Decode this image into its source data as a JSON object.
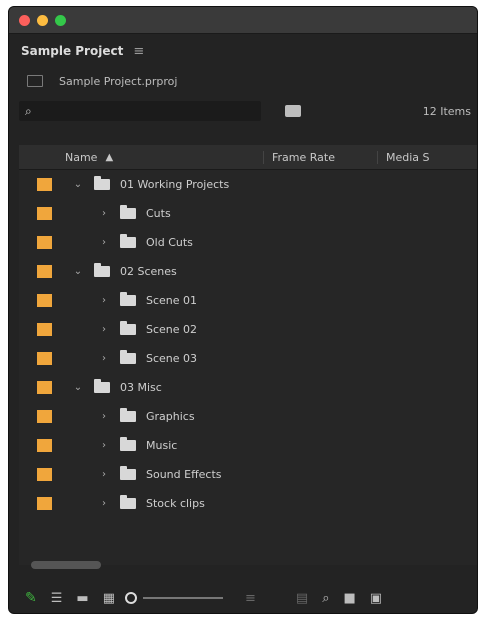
{
  "window": {
    "panel_title": "Sample Project",
    "panel_menu_icon": "hamburger-icon"
  },
  "project_file": {
    "name": "Sample Project.prproj"
  },
  "search": {
    "value": "",
    "items_count": "12 Items"
  },
  "columns": {
    "name": "Name",
    "frame_rate": "Frame Rate",
    "media_start": "Media S"
  },
  "rows": [
    {
      "label": "01 Working Projects",
      "level": 0,
      "expanded": true
    },
    {
      "label": "Cuts",
      "level": 1,
      "expanded": false
    },
    {
      "label": "Old Cuts",
      "level": 1,
      "expanded": false
    },
    {
      "label": "02 Scenes",
      "level": 0,
      "expanded": true
    },
    {
      "label": "Scene 01",
      "level": 1,
      "expanded": false
    },
    {
      "label": "Scene 02",
      "level": 1,
      "expanded": false
    },
    {
      "label": "Scene 03",
      "level": 1,
      "expanded": false
    },
    {
      "label": "03 Misc",
      "level": 0,
      "expanded": true
    },
    {
      "label": "Graphics",
      "level": 1,
      "expanded": false
    },
    {
      "label": "Music",
      "level": 1,
      "expanded": false
    },
    {
      "label": "Sound Effects",
      "level": 1,
      "expanded": false
    },
    {
      "label": "Stock clips",
      "level": 1,
      "expanded": false
    }
  ],
  "colors": {
    "label_swatch": "#f0a63c",
    "accent_green": "#3fb23f"
  }
}
